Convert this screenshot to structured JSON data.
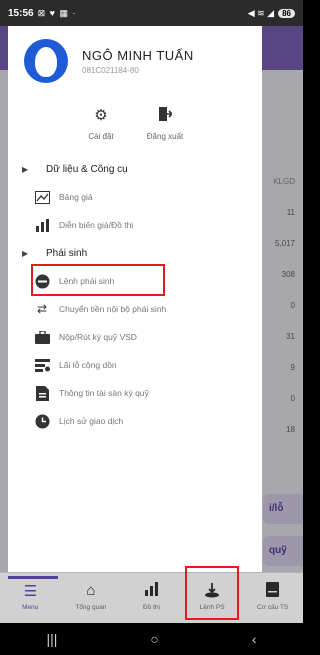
{
  "status_bar": {
    "time": "15:56",
    "left_icons": "⊠ ♥ ▦ ·",
    "right_icons": "◀ ≋ ◢",
    "battery": "86"
  },
  "profile": {
    "name": "NGÔ MINH TUẤN",
    "account_id": "081C021184-80"
  },
  "actions": [
    {
      "label": "Cài đặt",
      "icon": "gear-icon"
    },
    {
      "label": "Đăng xuất",
      "icon": "logout-icon"
    }
  ],
  "sections": {
    "data_tools": "Dữ liệu & Công cụ",
    "derivatives": "Phái sinh"
  },
  "data_items": [
    {
      "label": "Bảng giá",
      "icon": "price-board-icon"
    },
    {
      "label": "Diễn biến giá/Đồ thị",
      "icon": "chart-icon"
    }
  ],
  "deriv_items": [
    {
      "label": "Lệnh phái sinh",
      "icon": "order-icon"
    },
    {
      "label": "Chuyển tiền nội bộ phái sinh",
      "icon": "transfer-icon"
    },
    {
      "label": "Nộp/Rút ký quỹ VSD",
      "icon": "deposit-icon"
    },
    {
      "label": "Lãi lỗ cộng dồn",
      "icon": "profit-loss-icon"
    },
    {
      "label": "Thông tin tài sản ký quỹ",
      "icon": "margin-info-icon"
    },
    {
      "label": "Lịch sử giao dịch",
      "icon": "history-icon"
    }
  ],
  "background": {
    "column_header": "KLGD",
    "column_values": [
      "11",
      "5,017",
      "308",
      "0",
      "31",
      "9",
      "0",
      "18"
    ],
    "button_1": "i/lỗ",
    "button_2": "quỹ"
  },
  "bottom_nav": [
    {
      "label": "Menu",
      "icon": "menu-icon"
    },
    {
      "label": "Tổng quan",
      "icon": "home-icon"
    },
    {
      "label": "Đồ thị",
      "icon": "bar-chart-icon"
    },
    {
      "label": "Lệnh PS",
      "icon": "order-ps-icon"
    },
    {
      "label": "Cơ cấu TS",
      "icon": "portfolio-icon"
    }
  ],
  "colors": {
    "accent": "#6a4fc0",
    "highlight": "#e21d1d",
    "avatar": "#1f5bd6"
  }
}
